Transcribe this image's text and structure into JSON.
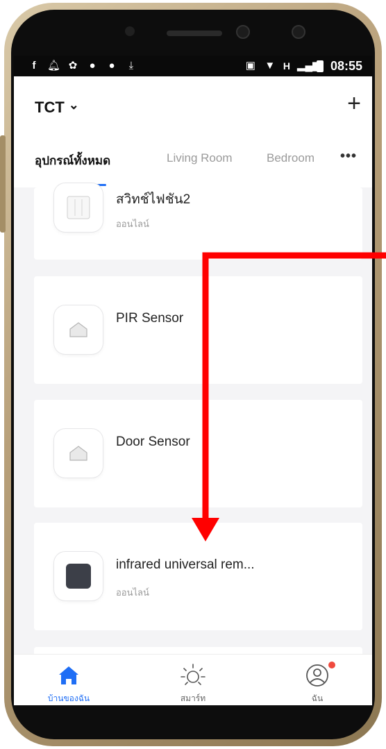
{
  "statusbar": {
    "left_icons": [
      "facebook-icon",
      "bell-icon",
      "aperture-icon",
      "line-icon",
      "line-icon",
      "download-icon"
    ],
    "right_icons": [
      "cast-icon",
      "wifi-icon",
      "signal-icon",
      "battery-icon"
    ],
    "network_type": "H",
    "time": "08:55"
  },
  "header": {
    "home_name": "TCT",
    "dropdown_glyph": "⌄",
    "add_glyph": "+"
  },
  "tabs": {
    "all": "อุปกรณ์ทั้งหมด",
    "living": "Living Room",
    "bedroom": "Bedroom",
    "more": "•••"
  },
  "devices": [
    {
      "name": "สวิทช์ไฟชัน2",
      "status": "ออนไลน์",
      "icon": "light-switch-icon"
    },
    {
      "name": "PIR Sensor",
      "status": "",
      "icon": "sensor-icon"
    },
    {
      "name": "Door Sensor",
      "status": "",
      "icon": "sensor-icon"
    },
    {
      "name": "infrared universal rem...",
      "status": "ออนไลน์",
      "icon": "ir-remote-icon"
    }
  ],
  "nav": {
    "home_label": "บ้านของฉัน",
    "smart_label": "สมาร์ท",
    "me_label": "ฉัน"
  },
  "colors": {
    "accent": "#1f6ef5",
    "annotation_arrow": "#ff0000",
    "notification": "#f04a3e"
  }
}
